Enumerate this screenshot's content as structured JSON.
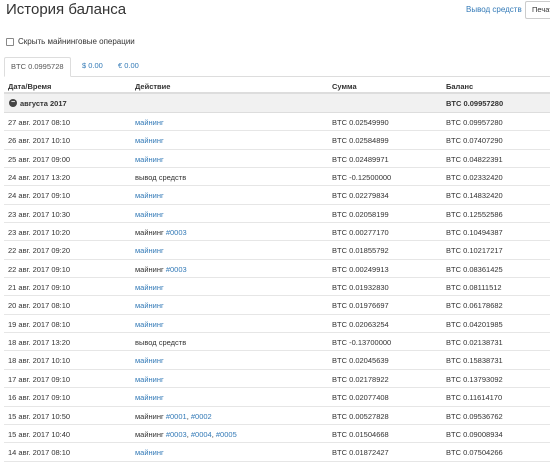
{
  "page": {
    "title": "История баланса",
    "withdraw_link": "Вывод средств",
    "print_button": "Печать"
  },
  "filter": {
    "hide_mining_label": "Скрыть майнинговые операции",
    "checked": false
  },
  "tabs": [
    {
      "label": "BTC 0.0995728",
      "active": true
    },
    {
      "label": "$ 0.00",
      "active": false
    },
    {
      "label": "€ 0.00",
      "active": false
    }
  ],
  "table": {
    "headers": {
      "date": "Дата/Время",
      "action": "Действие",
      "amount": "Сумма",
      "balance": "Баланс"
    },
    "group": {
      "title": "августа 2017",
      "balance": "BTC 0.09957280",
      "expanded": true
    },
    "rows": [
      {
        "date": "27 авг. 2017 08:10",
        "action": "майнинг",
        "action_is_link": true,
        "refs": [],
        "amount": "BTC 0.02549990",
        "balance": "BTC 0.09957280"
      },
      {
        "date": "26 авг. 2017 10:10",
        "action": "майнинг",
        "action_is_link": true,
        "refs": [],
        "amount": "BTC 0.02584899",
        "balance": "BTC 0.07407290"
      },
      {
        "date": "25 авг. 2017 09:00",
        "action": "майнинг",
        "action_is_link": true,
        "refs": [],
        "amount": "BTC 0.02489971",
        "balance": "BTC 0.04822391"
      },
      {
        "date": "24 авг. 2017 13:20",
        "action": "вывод средств",
        "action_is_link": false,
        "refs": [],
        "amount": "BTC -0.12500000",
        "balance": "BTC 0.02332420"
      },
      {
        "date": "24 авг. 2017 09:10",
        "action": "майнинг",
        "action_is_link": true,
        "refs": [],
        "amount": "BTC 0.02279834",
        "balance": "BTC 0.14832420"
      },
      {
        "date": "23 авг. 2017 10:30",
        "action": "майнинг",
        "action_is_link": true,
        "refs": [],
        "amount": "BTC 0.02058199",
        "balance": "BTC 0.12552586"
      },
      {
        "date": "23 авг. 2017 10:20",
        "action": "майнинг",
        "action_is_link": false,
        "refs": [
          "#0003"
        ],
        "amount": "BTC 0.00277170",
        "balance": "BTC 0.10494387"
      },
      {
        "date": "22 авг. 2017 09:20",
        "action": "майнинг",
        "action_is_link": true,
        "refs": [],
        "amount": "BTC 0.01855792",
        "balance": "BTC 0.10217217"
      },
      {
        "date": "22 авг. 2017 09:10",
        "action": "майнинг",
        "action_is_link": false,
        "refs": [
          "#0003"
        ],
        "amount": "BTC 0.00249913",
        "balance": "BTC 0.08361425"
      },
      {
        "date": "21 авг. 2017 09:10",
        "action": "майнинг",
        "action_is_link": true,
        "refs": [],
        "amount": "BTC 0.01932830",
        "balance": "BTC 0.08111512"
      },
      {
        "date": "20 авг. 2017 08:10",
        "action": "майнинг",
        "action_is_link": true,
        "refs": [],
        "amount": "BTC 0.01976697",
        "balance": "BTC 0.06178682"
      },
      {
        "date": "19 авг. 2017 08:10",
        "action": "майнинг",
        "action_is_link": true,
        "refs": [],
        "amount": "BTC 0.02063254",
        "balance": "BTC 0.04201985"
      },
      {
        "date": "18 авг. 2017 13:20",
        "action": "вывод средств",
        "action_is_link": false,
        "refs": [],
        "amount": "BTC -0.13700000",
        "balance": "BTC 0.02138731"
      },
      {
        "date": "18 авг. 2017 10:10",
        "action": "майнинг",
        "action_is_link": true,
        "refs": [],
        "amount": "BTC 0.02045639",
        "balance": "BTC 0.15838731"
      },
      {
        "date": "17 авг. 2017 09:10",
        "action": "майнинг",
        "action_is_link": true,
        "refs": [],
        "amount": "BTC 0.02178922",
        "balance": "BTC 0.13793092"
      },
      {
        "date": "16 авг. 2017 09:10",
        "action": "майнинг",
        "action_is_link": true,
        "refs": [],
        "amount": "BTC 0.02077408",
        "balance": "BTC 0.11614170"
      },
      {
        "date": "15 авг. 2017 10:50",
        "action": "майнинг",
        "action_is_link": false,
        "refs": [
          "#0001",
          "#0002"
        ],
        "amount": "BTC 0.00527828",
        "balance": "BTC 0.09536762"
      },
      {
        "date": "15 авг. 2017 10:40",
        "action": "майнинг",
        "action_is_link": false,
        "refs": [
          "#0003",
          "#0004",
          "#0005"
        ],
        "amount": "BTC 0.01504668",
        "balance": "BTC 0.09008934"
      },
      {
        "date": "14 авг. 2017 08:10",
        "action": "майнинг",
        "action_is_link": true,
        "refs": [],
        "amount": "BTC 0.01872427",
        "balance": "BTC 0.07504266"
      }
    ]
  },
  "colors": {
    "link": "#337ab7",
    "text": "#333333",
    "group_bg": "#f1f1f1",
    "border": "#dddddd"
  }
}
